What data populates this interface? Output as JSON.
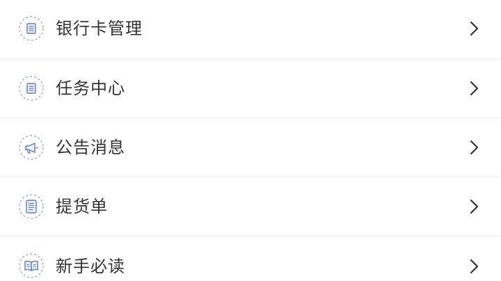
{
  "menu": {
    "items": [
      {
        "label": "银行卡管理",
        "icon": "document-list-icon"
      },
      {
        "label": "任务中心",
        "icon": "document-list-icon"
      },
      {
        "label": "公告消息",
        "icon": "megaphone-icon"
      },
      {
        "label": "提货单",
        "icon": "receipt-list-icon"
      },
      {
        "label": "新手必读",
        "icon": "open-book-icon"
      }
    ]
  },
  "colors": {
    "icon_stroke": "#5b78c8",
    "icon_dashed_ring": "#9fb0dc",
    "text": "#333333",
    "chevron": "#333333",
    "divider": "#f0f1f3"
  }
}
